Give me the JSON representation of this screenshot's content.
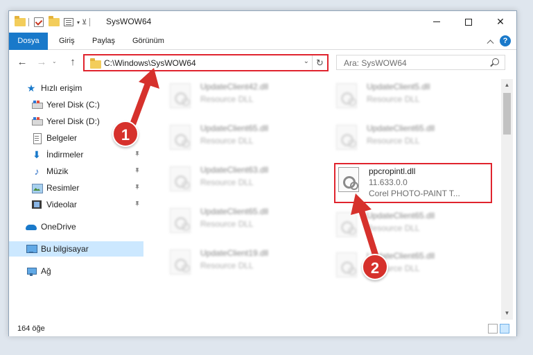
{
  "window": {
    "title": "SysWOW64"
  },
  "ribbon": {
    "tabs": [
      {
        "label": "Dosya"
      },
      {
        "label": "Giriş"
      },
      {
        "label": "Paylaş"
      },
      {
        "label": "Görünüm"
      }
    ],
    "help": "?"
  },
  "navigation": {
    "address": "C:\\Windows\\SysWOW64",
    "search_placeholder": "Ara: SysWOW64"
  },
  "sidebar": {
    "items": [
      {
        "label": "Hızlı erişim",
        "icon": "star-icon"
      },
      {
        "label": "Yerel Disk (C:)",
        "icon": "disk-icon"
      },
      {
        "label": "Yerel Disk (D:)",
        "icon": "disk-icon"
      },
      {
        "label": "Belgeler",
        "icon": "document-icon"
      },
      {
        "label": "İndirmeler",
        "icon": "download-icon"
      },
      {
        "label": "Müzik",
        "icon": "music-icon"
      },
      {
        "label": "Resimler",
        "icon": "pictures-icon"
      },
      {
        "label": "Videolar",
        "icon": "video-icon"
      },
      {
        "label": "OneDrive",
        "icon": "cloud-icon"
      },
      {
        "label": "Bu bilgisayar",
        "icon": "computer-icon"
      },
      {
        "label": "Ağ",
        "icon": "network-icon"
      }
    ]
  },
  "files": [
    {
      "name": "UpdateClient42.dll",
      "desc": "Resource DLL"
    },
    {
      "name": "UpdateClient5.dll",
      "desc": "Resource DLL"
    },
    {
      "name": "UpdateClient65.dll",
      "desc": "Resource DLL"
    },
    {
      "name": "UpdateClient65.dll",
      "desc": "Resource DLL"
    },
    {
      "name": "UpdateClient63.dll",
      "desc": "Resource DLL"
    },
    {
      "name": "ppcropintl.dll",
      "version": "11.633.0.0",
      "desc": "Corel PHOTO-PAINT T..."
    },
    {
      "name": "UpdateClient65.dll",
      "desc": "Resource DLL"
    },
    {
      "name": "UpdateClient65.dll",
      "desc": "Resource DLL"
    },
    {
      "name": "UpdateClient19.dll",
      "desc": "Resource DLL"
    },
    {
      "name": "UpdateClient65.dll",
      "desc": "Resource DLL"
    }
  ],
  "status": {
    "count": "164 öğe"
  },
  "callouts": {
    "one": "1",
    "two": "2",
    "color": "#d6312c"
  },
  "colors": {
    "accent": "#1979ca",
    "highlight_border": "#e0232d"
  }
}
